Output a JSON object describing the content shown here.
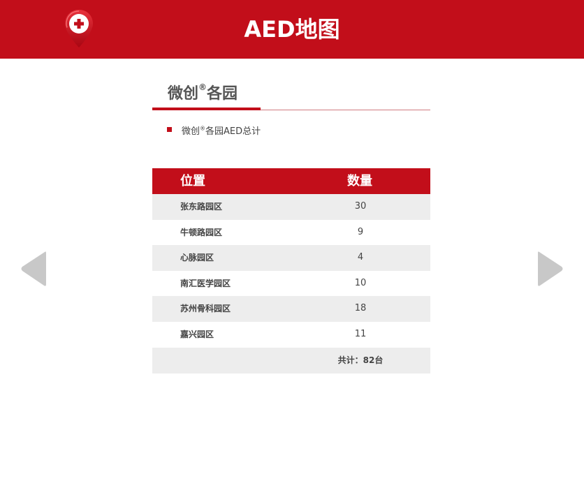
{
  "header": {
    "title": "AED地图",
    "logo_icon": "map-pin-medical-icon",
    "bg_color": "#c20e1a"
  },
  "section": {
    "title": "微创",
    "title_suffix": "各园",
    "registered": "®"
  },
  "bullet": {
    "text_prefix": "微创",
    "registered": "®",
    "text_suffix": "各园AED总计"
  },
  "table": {
    "headers": [
      "位置",
      "数量"
    ],
    "rows": [
      {
        "location": "张东路园区",
        "count": "30"
      },
      {
        "location": "牛顿路园区",
        "count": "9"
      },
      {
        "location": "心脉园区",
        "count": "4"
      },
      {
        "location": "南汇医学园区",
        "count": "10"
      },
      {
        "location": "苏州骨科园区",
        "count": "18"
      },
      {
        "location": "嘉兴园区",
        "count": "11"
      }
    ],
    "total": "共计：82台"
  },
  "nav": {
    "prev_icon": "triangle-left-icon",
    "next_icon": "triangle-right-icon"
  }
}
